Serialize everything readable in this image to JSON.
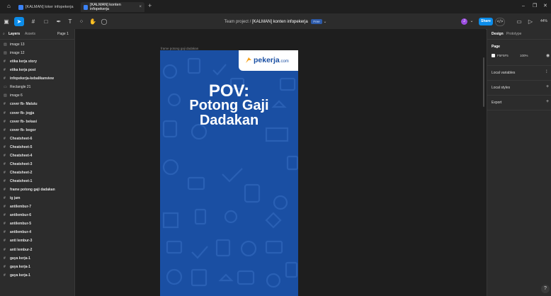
{
  "browser": {
    "tabs": [
      {
        "label": "[KALMAN] loker infopekerja",
        "active": false
      },
      {
        "label": "[KALMAN] konten infopekerja",
        "active": true
      }
    ]
  },
  "toolbar": {
    "breadcrumb_team": "Team project",
    "breadcrumb_sep": "/",
    "file_name": "[KALMAN] konten infopekerja",
    "plan_badge": "Free",
    "user_initial": "J",
    "share_label": "Share",
    "zoom_label": "44%"
  },
  "left_panel": {
    "tab_layers": "Layers",
    "tab_assets": "Assets",
    "page_label": "Page 1",
    "layers": [
      {
        "name": "image 13",
        "icon": "image-icon",
        "bold": false
      },
      {
        "name": "image 12",
        "icon": "image-icon",
        "bold": false
      },
      {
        "name": "etika kerja story",
        "icon": "frame-icon",
        "bold": true
      },
      {
        "name": "etika kerja post",
        "icon": "frame-icon",
        "bold": true
      },
      {
        "name": "infopekerja-kebalikanview",
        "icon": "frame-icon",
        "bold": true
      },
      {
        "name": "Rectangle 21",
        "icon": "rectangle-icon",
        "bold": false
      },
      {
        "name": "image 6",
        "icon": "image-icon",
        "bold": false
      },
      {
        "name": "cover fb- Malutu",
        "icon": "frame-icon",
        "bold": true
      },
      {
        "name": "cover fb- jogja",
        "icon": "frame-icon",
        "bold": true
      },
      {
        "name": "cover fb- bekasi",
        "icon": "frame-icon",
        "bold": true
      },
      {
        "name": "cover fb- bogor",
        "icon": "frame-icon",
        "bold": true
      },
      {
        "name": "Cheatsheet-6",
        "icon": "frame-icon",
        "bold": true
      },
      {
        "name": "Cheatsheet-5",
        "icon": "frame-icon",
        "bold": true
      },
      {
        "name": "Cheatsheet-4",
        "icon": "frame-icon",
        "bold": true
      },
      {
        "name": "Cheatsheet-3",
        "icon": "frame-icon",
        "bold": true
      },
      {
        "name": "Cheatsheet-2",
        "icon": "frame-icon",
        "bold": true
      },
      {
        "name": "Cheatsheet-1",
        "icon": "frame-icon",
        "bold": true
      },
      {
        "name": "frame potong gaji dadakan",
        "icon": "frame-icon",
        "bold": true
      },
      {
        "name": "ig jam",
        "icon": "frame-icon",
        "bold": true
      },
      {
        "name": "antilembur-7",
        "icon": "frame-icon",
        "bold": true
      },
      {
        "name": "antilembur-6",
        "icon": "frame-icon",
        "bold": true
      },
      {
        "name": "antilembur-5",
        "icon": "frame-icon",
        "bold": true
      },
      {
        "name": "antilembur-4",
        "icon": "frame-icon",
        "bold": true
      },
      {
        "name": "anti lembur-3",
        "icon": "frame-icon",
        "bold": true
      },
      {
        "name": "anti lembur-2",
        "icon": "frame-icon",
        "bold": true
      },
      {
        "name": "gaya kerja-1",
        "icon": "frame-icon",
        "bold": true
      },
      {
        "name": "gaya kerja-1",
        "icon": "frame-icon",
        "bold": true
      },
      {
        "name": "gaya kerja-1",
        "icon": "frame-icon",
        "bold": true
      }
    ]
  },
  "canvas": {
    "frame_label": "frame potong gaji dadakan",
    "logo_text": "pekerja",
    "logo_suffix": ".com",
    "headline_line1": "POV:",
    "headline_line2": "Potong Gaji",
    "headline_line3": "Dadakan",
    "frame_color": "#1a4fa3"
  },
  "right_panel": {
    "tab_design": "Design",
    "tab_prototype": "Prototype",
    "page_title": "Page",
    "page_color_hex": "F5F5F5",
    "page_opacity": "100%",
    "local_variables": "Local variables",
    "local_styles": "Local styles",
    "export_label": "Export"
  },
  "colors": {
    "accent": "#0c8ce9",
    "panel": "#2c2c2c",
    "canvas": "#1e1e1e",
    "avatar": "#9b4de0"
  }
}
